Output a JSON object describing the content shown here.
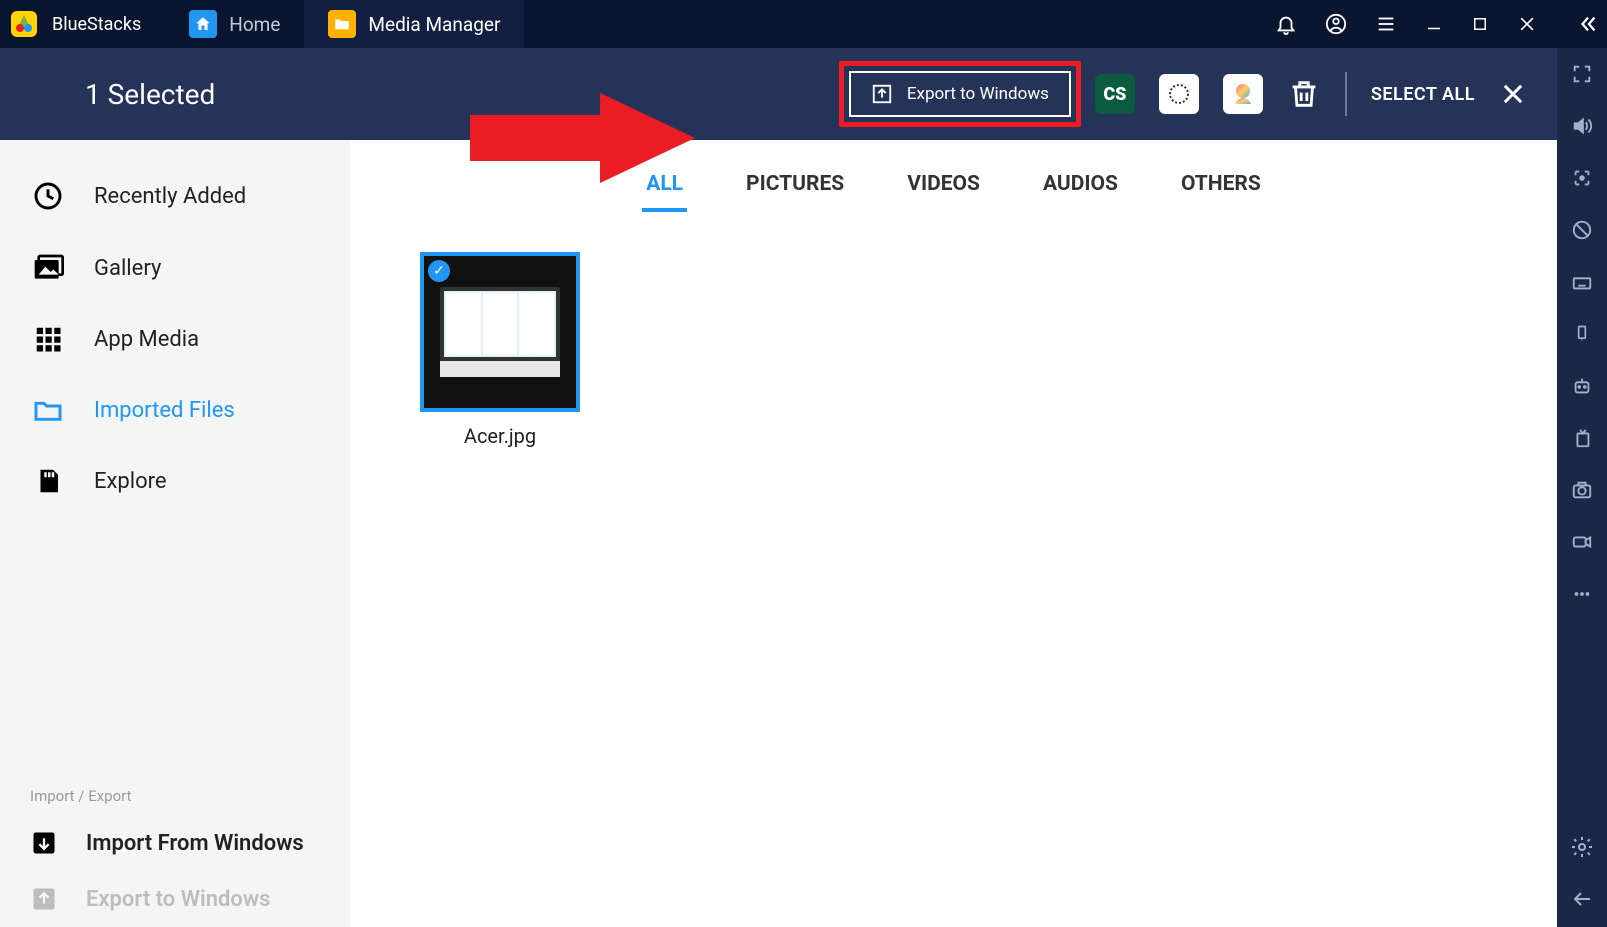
{
  "app": {
    "name": "BlueStacks"
  },
  "tabs": [
    {
      "label": "Home"
    },
    {
      "label": "Media Manager"
    }
  ],
  "selection": {
    "count_text": "1 Selected",
    "export_label": "Export to Windows",
    "select_all_label": "SELECT ALL"
  },
  "sidebar": {
    "items": [
      {
        "label": "Recently Added"
      },
      {
        "label": "Gallery"
      },
      {
        "label": "App Media"
      },
      {
        "label": "Imported Files"
      },
      {
        "label": "Explore"
      }
    ],
    "section_header": "Import / Export",
    "import_label": "Import From Windows",
    "export_label": "Export to Windows"
  },
  "filters": {
    "all": "ALL",
    "pictures": "PICTURES",
    "videos": "VIDEOS",
    "audios": "AUDIOS",
    "others": "OTHERS"
  },
  "files": [
    {
      "name": "Acer.jpg"
    }
  ]
}
